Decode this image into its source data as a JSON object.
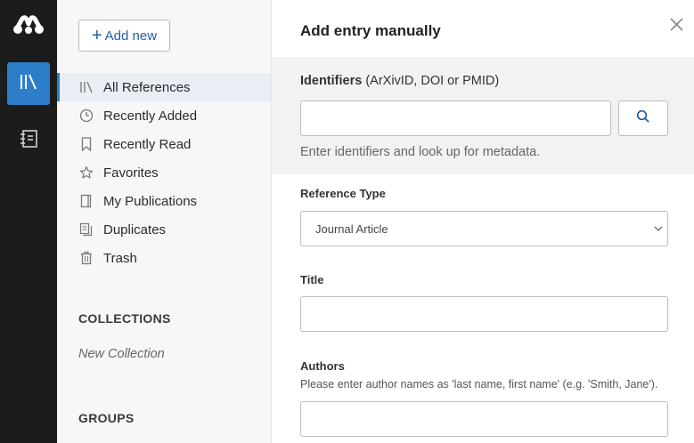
{
  "rail": {
    "logo_icon": "mendeley-logo-icon",
    "library_icon": "library-icon",
    "notebook_icon": "notebook-icon",
    "accent": "#2d7ec9"
  },
  "sidebar": {
    "add_new_label": "Add new",
    "items": [
      {
        "label": "All References",
        "icon": "library-icon",
        "active": true
      },
      {
        "label": "Recently Added",
        "icon": "clock-icon"
      },
      {
        "label": "Recently Read",
        "icon": "bookmark-icon"
      },
      {
        "label": "Favorites",
        "icon": "star-icon"
      },
      {
        "label": "My Publications",
        "icon": "publication-icon"
      },
      {
        "label": "Duplicates",
        "icon": "duplicates-icon"
      },
      {
        "label": "Trash",
        "icon": "trash-icon"
      }
    ],
    "collections_heading": "COLLECTIONS",
    "new_collection": "New Collection",
    "groups_heading": "GROUPS"
  },
  "panel": {
    "title": "Add entry manually",
    "identifiers_label_bold": "Identifiers",
    "identifiers_label_rest": "(ArXivID, DOI or PMID)",
    "identifiers_value": "",
    "identifiers_hint": "Enter identifiers and look up for metadata.",
    "reference_type_label": "Reference Type",
    "reference_type_value": "Journal Article",
    "title_label": "Title",
    "title_value": "",
    "authors_label": "Authors",
    "authors_hint": "Please enter author names as 'last name, first name' (e.g. 'Smith, Jane').",
    "authors_value": ""
  }
}
